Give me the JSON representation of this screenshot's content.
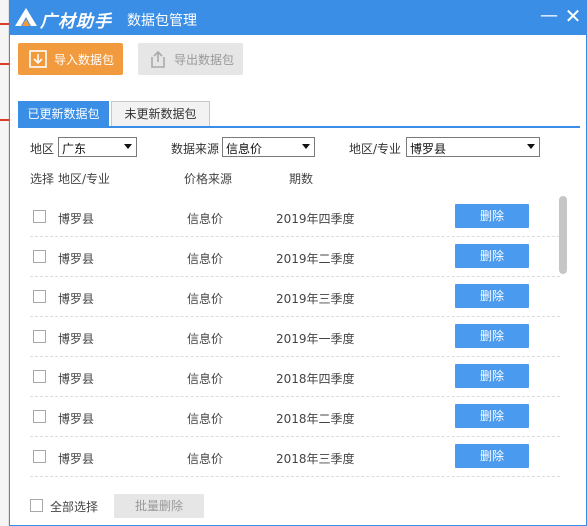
{
  "window": {
    "logo_text": "广材助手",
    "title": "数据包管理",
    "minimize_symbol": "—",
    "close_symbol": "✕"
  },
  "toolbar": {
    "import_label": "导入数据包",
    "export_label": "导出数据包"
  },
  "tabs": [
    {
      "label": "已更新数据包",
      "active": true
    },
    {
      "label": "未更新数据包",
      "active": false
    }
  ],
  "filters": {
    "region_label": "地区",
    "region_value": "广东",
    "source_label": "数据来源",
    "source_value": "信息价",
    "specialty_label": "地区/专业",
    "specialty_value": "博罗县"
  },
  "table": {
    "headers": {
      "select": "选择",
      "region": "地区/专业",
      "source": "价格来源",
      "period": "期数"
    },
    "delete_label": "删除",
    "rows": [
      {
        "region": "博罗县",
        "source": "信息价",
        "period": "2019年四季度"
      },
      {
        "region": "博罗县",
        "source": "信息价",
        "period": "2019年二季度"
      },
      {
        "region": "博罗县",
        "source": "信息价",
        "period": "2019年三季度"
      },
      {
        "region": "博罗县",
        "source": "信息价",
        "period": "2019年一季度"
      },
      {
        "region": "博罗县",
        "source": "信息价",
        "period": "2018年四季度"
      },
      {
        "region": "博罗县",
        "source": "信息价",
        "period": "2018年二季度"
      },
      {
        "region": "博罗县",
        "source": "信息价",
        "period": "2018年三季度"
      }
    ]
  },
  "footer": {
    "select_all_label": "全部选择",
    "batch_delete_label": "批量删除"
  },
  "icons": {
    "import": "import-icon",
    "export": "export-icon",
    "logo": "logo-icon"
  },
  "colors": {
    "primary": "#3a8ee6",
    "import_button": "#f19a3e",
    "delete_button": "#4a9bf0",
    "disabled": "#e6e6e6"
  }
}
